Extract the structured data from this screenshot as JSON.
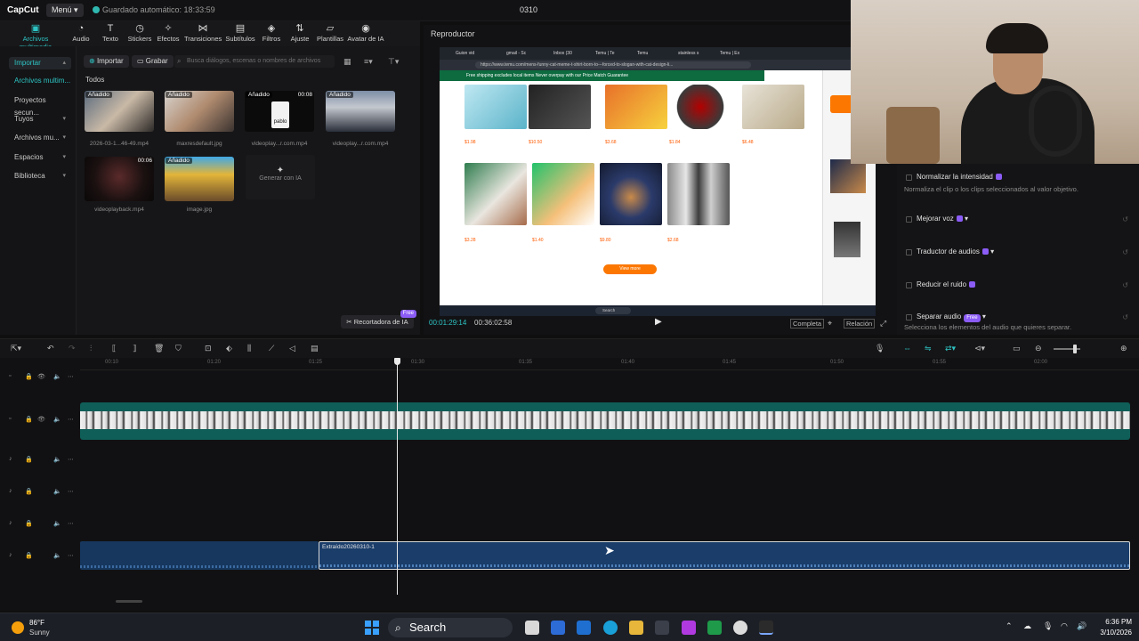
{
  "titlebar": {
    "logo": "CapCut",
    "menu_label": "Menú",
    "autosave": "Guardado automático: 18:33:59",
    "project_name": "0310"
  },
  "toolbar": {
    "items": [
      {
        "label": "Archivos multimedia",
        "icon": "media-icon"
      },
      {
        "label": "Audio",
        "icon": "audio-icon"
      },
      {
        "label": "Texto",
        "icon": "text-icon"
      },
      {
        "label": "Stickers",
        "icon": "sticker-icon"
      },
      {
        "label": "Efectos",
        "icon": "effects-icon"
      },
      {
        "label": "Transiciones",
        "icon": "transition-icon"
      },
      {
        "label": "Subtítulos",
        "icon": "subtitle-icon"
      },
      {
        "label": "Filtros",
        "icon": "filter-icon"
      },
      {
        "label": "Ajuste",
        "icon": "adjust-icon"
      },
      {
        "label": "Plantillas",
        "icon": "template-icon"
      },
      {
        "label": "Avatar de IA",
        "icon": "avatar-icon"
      }
    ]
  },
  "leftnav": {
    "items": [
      {
        "label": "Importar"
      },
      {
        "label": "Archivos multim..."
      },
      {
        "label": "Proyectos secun..."
      },
      {
        "label": "Tuyos"
      },
      {
        "label": "Archivos mu..."
      },
      {
        "label": "Espacios"
      },
      {
        "label": "Biblioteca"
      }
    ]
  },
  "media": {
    "import_label": "Importar",
    "record_label": "Grabar",
    "search_placeholder": "Busca diálogos, escenas o nombres de archivos",
    "filter_label": "Todos",
    "items": [
      {
        "tag": "Añadido",
        "duration": "",
        "name": "2026-03-1...46-49.mp4"
      },
      {
        "tag": "Añadido",
        "duration": "",
        "name": "maxresdefault.jpg"
      },
      {
        "tag": "Añadido",
        "duration": "00:08",
        "name": "videoplay...r.com.mp4",
        "overlay_text": "pablo"
      },
      {
        "tag": "Añadido",
        "duration": "",
        "name": "videoplay...r.com.mp4"
      },
      {
        "tag": "",
        "duration": "00:06",
        "name": "videoplayback.mp4"
      },
      {
        "tag": "Añadido",
        "duration": "",
        "name": "image.jpg"
      }
    ],
    "ai_generate_label": "Generar con IA",
    "cutout_label": "Recortadora de IA",
    "cutout_badge": "Free"
  },
  "player": {
    "title": "Reproductor",
    "current_time": "00:01:29:14",
    "total_time": "00:36:02:58",
    "full_label": "Completa",
    "ratio_label": "Relación",
    "screen": {
      "url": "https://www.temu.com/mens-funny-cat-meme-t-shirt-born-to---forced-to-slogan-with-cat-design-li...",
      "tabs": [
        "Guion vid",
        "gmail - Sc",
        "Inbox (30",
        "Temu | Te",
        "Temu",
        "stainless s",
        "Temu | Ex"
      ],
      "ship_banner": "Free shipping excludes local items     Never overpay with our Price Match Guarantee",
      "view_more": "View more",
      "taskbar_search": "Search"
    }
  },
  "right_panel": {
    "options": [
      {
        "label": "Normalizar la intensidad",
        "desc": "Normaliza el clip o los clips seleccionados al valor objetivo.",
        "badge": "pro"
      },
      {
        "label": "Mejorar voz",
        "desc": "",
        "badge": "pro"
      },
      {
        "label": "Traductor de audios",
        "desc": "",
        "badge": "pro"
      },
      {
        "label": "Reducir el ruido",
        "desc": "",
        "badge": "pro"
      },
      {
        "label": "Separar audio",
        "desc": "Selecciona los elementos del audio que quieres separar.",
        "badge": "Free"
      }
    ]
  },
  "timeline": {
    "ruler_ticks": [
      "00:10",
      "01:20",
      "01:25",
      "01:30",
      "01:35",
      "01:40",
      "01:45",
      "01:50",
      "01:55",
      "02:00"
    ],
    "audio_clip_name": "Extraído20260310-1"
  },
  "taskbar": {
    "weather_temp": "86°F",
    "weather_desc": "Sunny",
    "search_label": "Search",
    "time": "6:36 PM",
    "date": "3/10/2026"
  },
  "colors": {
    "accent": "#2ec4c4",
    "pro_badge": "#8b5cf6",
    "video_track": "#0f5e58",
    "audio_track": "#1a3d6a"
  }
}
